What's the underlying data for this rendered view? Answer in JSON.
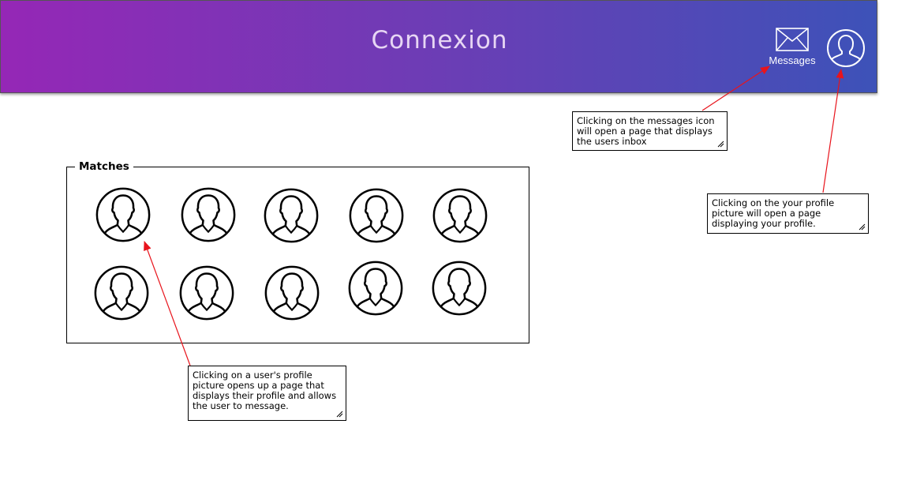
{
  "header": {
    "brand": "Connexion",
    "messages_label": "Messages"
  },
  "matches": {
    "title": "Matches",
    "profiles": [
      {
        "icon": "user-avatar-icon"
      },
      {
        "icon": "user-avatar-icon"
      },
      {
        "icon": "user-avatar-icon"
      },
      {
        "icon": "user-avatar-icon"
      },
      {
        "icon": "user-avatar-icon"
      },
      {
        "icon": "user-avatar-icon"
      },
      {
        "icon": "user-avatar-icon"
      },
      {
        "icon": "user-avatar-icon"
      },
      {
        "icon": "user-avatar-icon"
      },
      {
        "icon": "user-avatar-icon"
      }
    ]
  },
  "annotations": {
    "messages_note": "Clicking on the messages icon will open a page that displays the users inbox",
    "profile_note": "Clicking on the your profile picture will open a page displaying your profile.",
    "match_note": "Clicking on a user's profile picture opens up a page that displays their profile and allows the user to message."
  },
  "colors": {
    "header_gradient_start": "#9527b6",
    "header_gradient_end": "#3d52b8",
    "arrow": "#e8141c"
  }
}
